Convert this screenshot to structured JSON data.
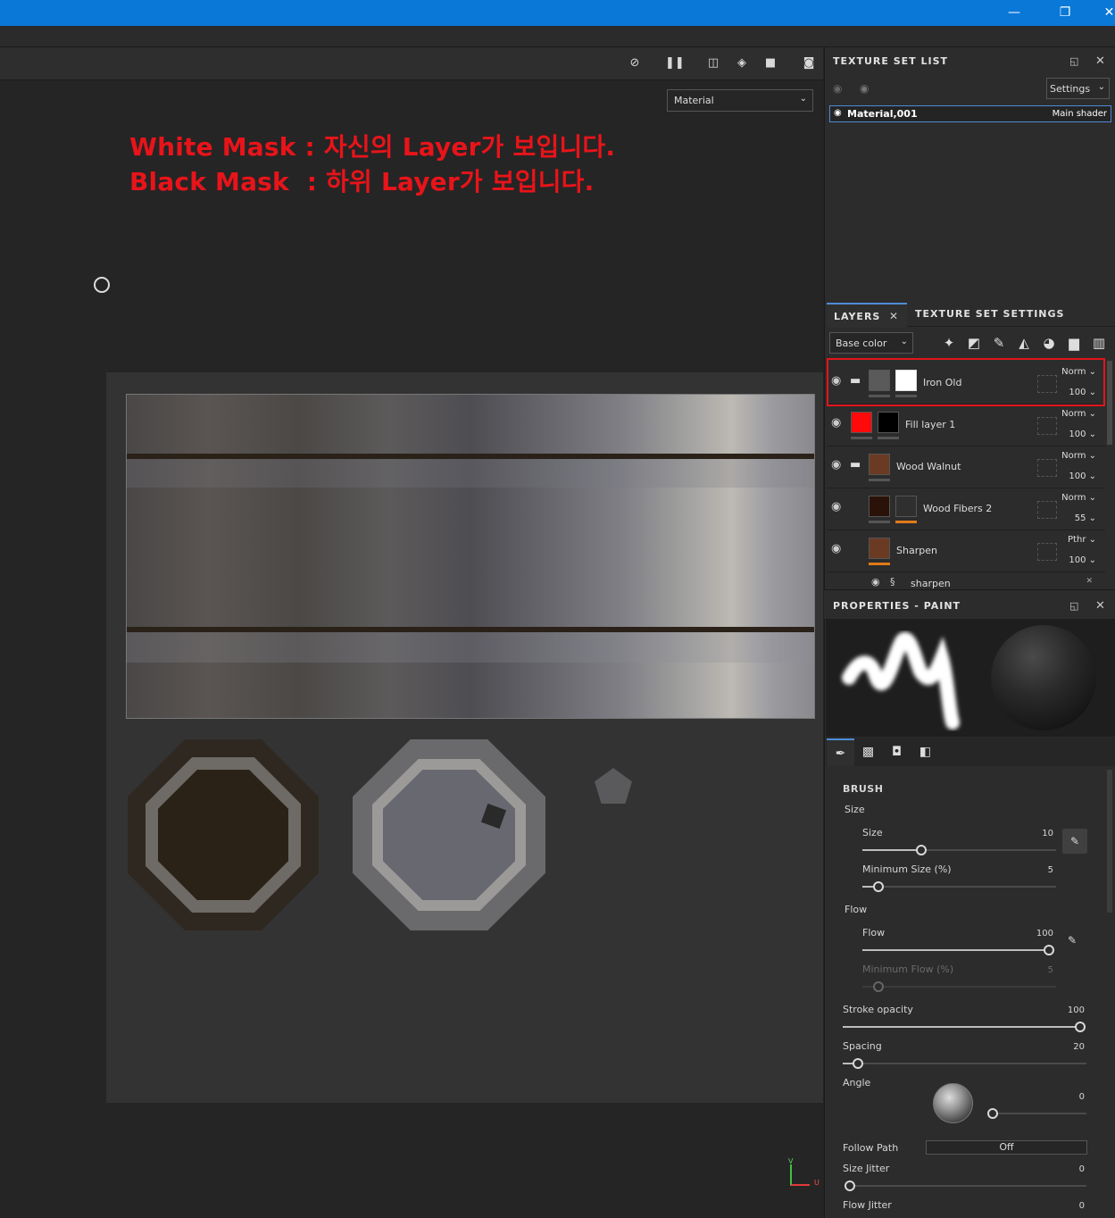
{
  "window": {
    "minimize_glyph": "—",
    "restore_glyph": "❐",
    "close_glyph": "✕"
  },
  "viewport": {
    "material_dropdown": "Material",
    "annotation_line1": "White Mask : 자신의 Layer가 보입니다.",
    "annotation_line2": "Black Mask  : 하위 Layer가 보입니다.",
    "axis_v": "V",
    "axis_u": "U"
  },
  "texture_set_list": {
    "title": "TEXTURE SET LIST",
    "settings_label": "Settings",
    "row": {
      "name": "Material,001",
      "shader": "Main shader"
    }
  },
  "layers_panel": {
    "tabs": [
      {
        "label": "LAYERS"
      },
      {
        "label": "TEXTURE SET SETTINGS"
      }
    ],
    "channel": "Base color",
    "layers": [
      {
        "name": "Iron Old",
        "blend": "Norm",
        "opacity": "100"
      },
      {
        "name": "Fill layer 1",
        "blend": "Norm",
        "opacity": "100"
      },
      {
        "name": "Wood Walnut",
        "blend": "Norm",
        "opacity": "100"
      },
      {
        "name": "Wood Fibers 2",
        "blend": "Norm",
        "opacity": "55"
      },
      {
        "name": "Sharpen",
        "blend": "Pthr",
        "opacity": "100"
      }
    ],
    "sub_effect": "sharpen"
  },
  "properties": {
    "title": "PROPERTIES - PAINT",
    "section": "BRUSH",
    "size_group": "Size",
    "size": {
      "label": "Size",
      "value": "10",
      "fraction": 0.3
    },
    "min_size": {
      "label": "Minimum Size (%)",
      "value": "5",
      "fraction": 0.08
    },
    "flow_group": "Flow",
    "flow": {
      "label": "Flow",
      "value": "100",
      "fraction": 1.0
    },
    "min_flow": {
      "label": "Minimum Flow (%)",
      "value": "5",
      "fraction": 0.08
    },
    "stroke_opacity": {
      "label": "Stroke opacity",
      "value": "100",
      "fraction": 1.0
    },
    "spacing": {
      "label": "Spacing",
      "value": "20",
      "fraction": 0.06
    },
    "angle": {
      "label": "Angle",
      "value": "0",
      "fraction": 0.0
    },
    "follow_path": {
      "label": "Follow Path",
      "value": "Off"
    },
    "size_jitter": {
      "label": "Size Jitter",
      "value": "0",
      "fraction": 0.0
    },
    "flow_jitter": {
      "label": "Flow Jitter",
      "value": "0"
    }
  },
  "colors": {
    "accent": "#4d8dd8",
    "titlebar": "#0a78d7",
    "highlight": "#e3141b",
    "annotation": "#e8141a"
  }
}
